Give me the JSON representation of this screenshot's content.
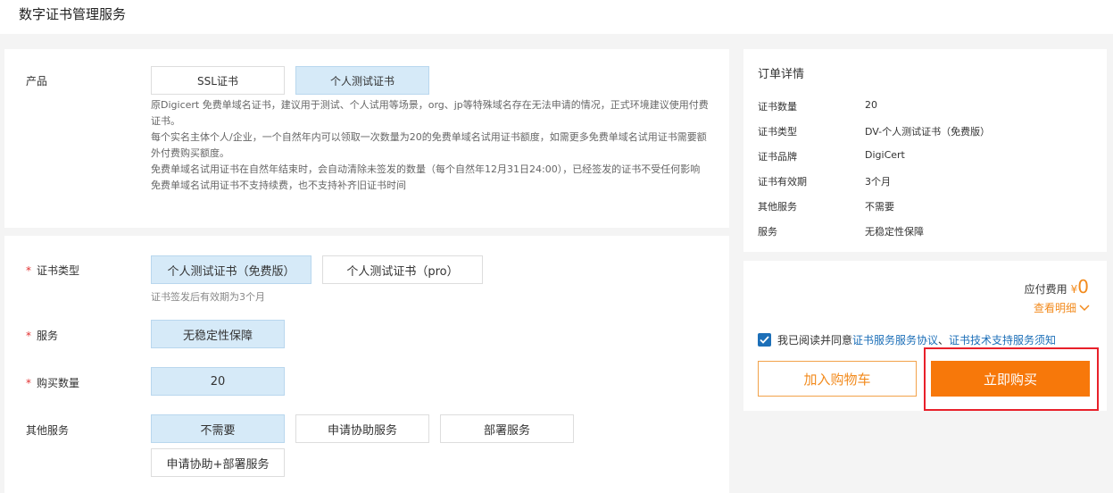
{
  "page": {
    "title": "数字证书管理服务"
  },
  "product": {
    "label": "产品",
    "options": [
      "SSL证书",
      "个人测试证书"
    ],
    "selected": "个人测试证书",
    "description": [
      "原Digicert 免费单域名证书，建议用于测试、个人试用等场景，org、jp等特殊域名存在无法申请的情况，正式环境建议使用付费证书。",
      "每个实名主体个人/企业，一个自然年内可以领取一次数量为20的免费单域名试用证书额度，如需更多免费单域名试用证书需要额外付费购买额度。",
      "免费单域名试用证书在自然年结束时，会自动清除未签发的数量（每个自然年12月31日24:00），已经签发的证书不受任何影响",
      "免费单域名试用证书不支持续费，也不支持补齐旧证书时间"
    ]
  },
  "cert_type": {
    "label": "证书类型",
    "options": [
      "个人测试证书（免费版）",
      "个人测试证书（pro）"
    ],
    "selected": "个人测试证书（免费版）",
    "hint": "证书签发后有效期为3个月"
  },
  "service": {
    "label": "服务",
    "options": [
      "无稳定性保障"
    ],
    "selected": "无稳定性保障"
  },
  "quantity": {
    "label": "购买数量",
    "value": "20"
  },
  "other_services": {
    "label": "其他服务",
    "options": [
      "不需要",
      "申请协助服务",
      "部署服务",
      "申请协助+部署服务"
    ],
    "selected": "不需要"
  },
  "order": {
    "title": "订单详情",
    "rows": [
      {
        "label": "证书数量",
        "value": "20"
      },
      {
        "label": "证书类型",
        "value": "DV-个人测试证书（免费版）"
      },
      {
        "label": "证书品牌",
        "value": "DigiCert"
      },
      {
        "label": "证书有效期",
        "value": "3个月"
      },
      {
        "label": "其他服务",
        "value": "不需要"
      },
      {
        "label": "服务",
        "value": "无稳定性保障"
      }
    ]
  },
  "payment": {
    "fee_label": "应付费用",
    "currency": "¥",
    "amount": "0",
    "detail_link": "查看明细",
    "agree_prefix": "我已阅读并同意",
    "agreement_1": "证书服务服务协议",
    "separator": "、",
    "agreement_2": "证书技术支持服务须知",
    "add_to_cart": "加入购物车",
    "buy_now": "立即购买"
  },
  "colors": {
    "accent_orange": "#f7780a",
    "selected_bg": "#d6eaf8",
    "link_blue": "#1c6fb8",
    "highlight_red": "#e8202a"
  }
}
